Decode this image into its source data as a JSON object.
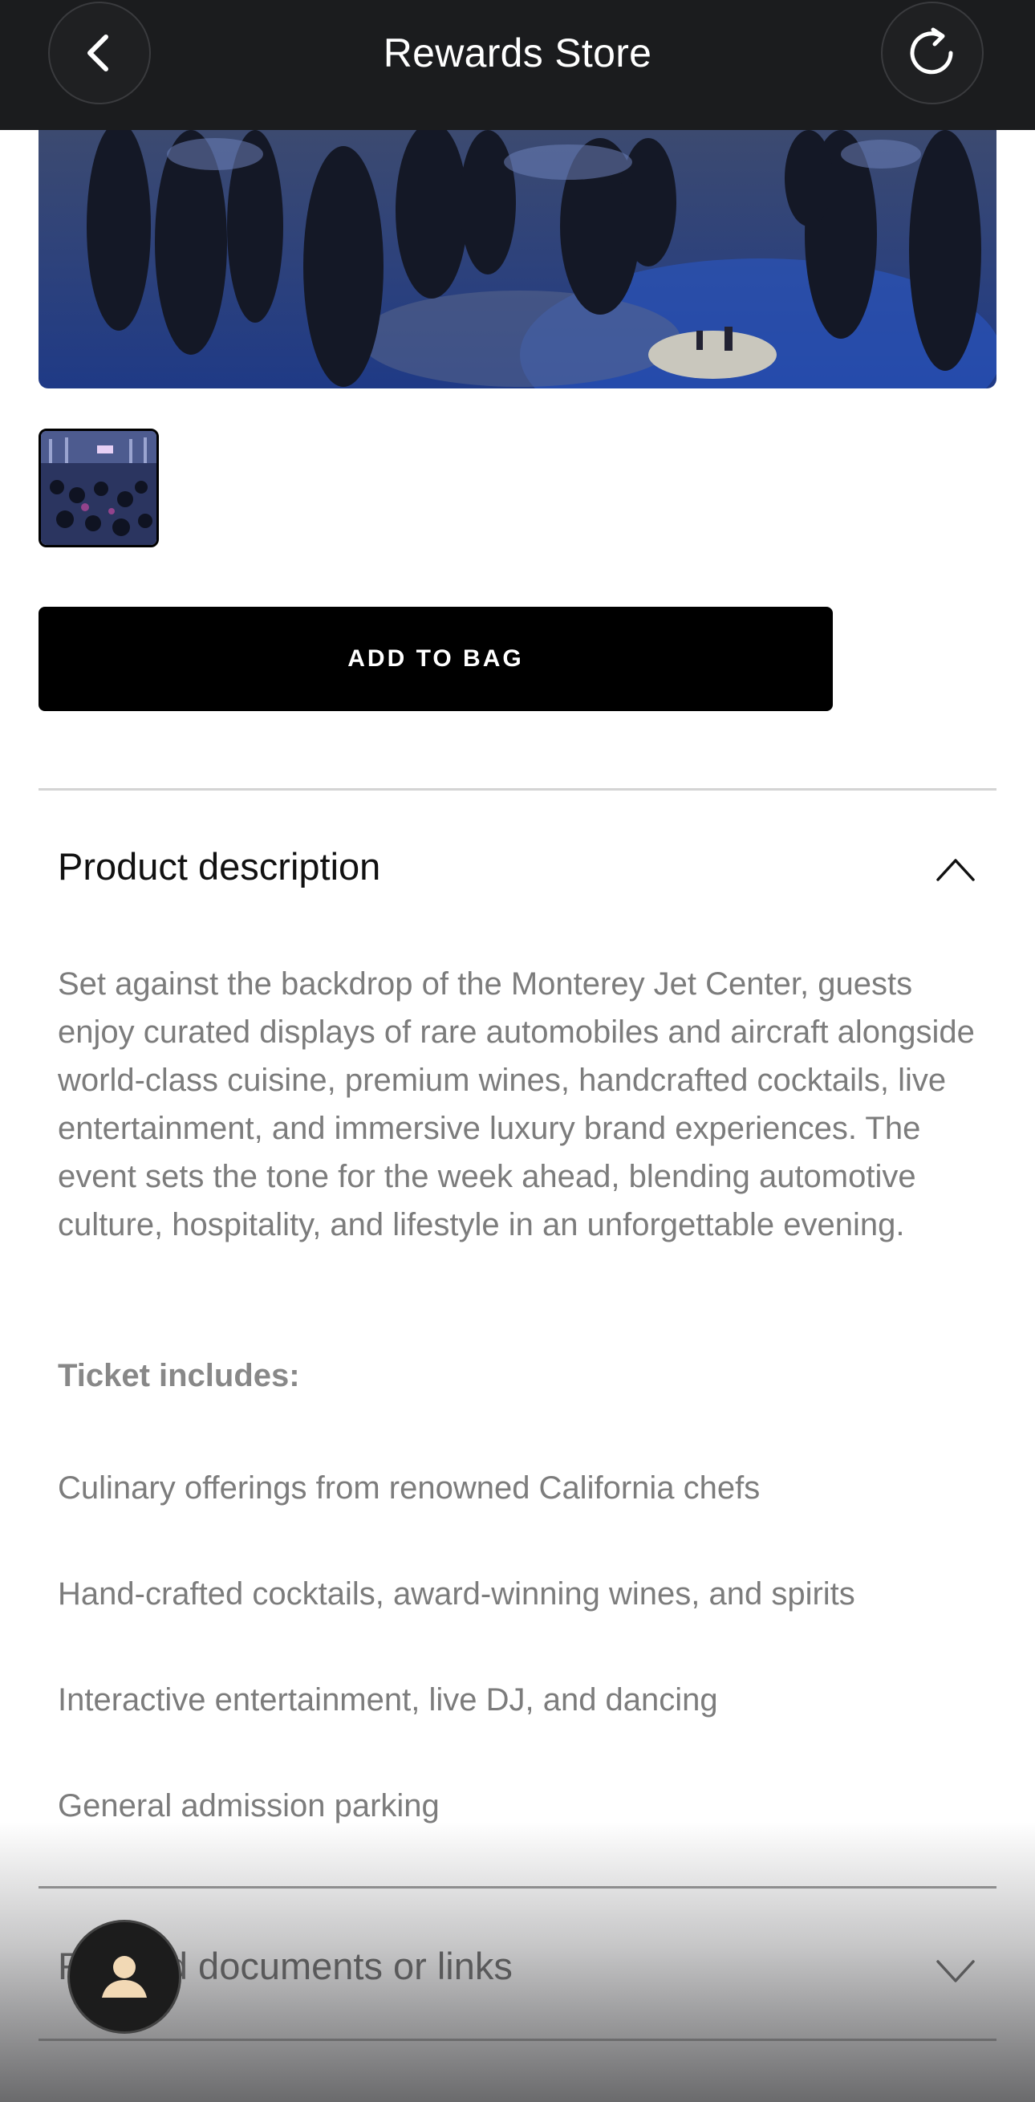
{
  "header": {
    "title": "Rewards Store",
    "back_icon": "chevron-left-icon",
    "refresh_icon": "refresh-icon"
  },
  "product": {
    "add_to_bag_label": "ADD TO BAG"
  },
  "description_section": {
    "title": "Product description",
    "expanded": true,
    "body": "Set against the backdrop of the Monterey Jet Center, guests enjoy curated displays of rare automobiles and aircraft alongside world-class cuisine, premium wines, handcrafted cocktails, live entertainment, and immersive luxury brand experiences. The event sets the tone for the week ahead, blending automotive culture, hospitality, and lifestyle in an unforgettable evening.",
    "includes_title": "Ticket includes:",
    "includes": [
      "Culinary offerings from renowned California chefs",
      "Hand-crafted cocktails, award-winning wines, and spirits",
      "Interactive entertainment, live DJ, and dancing",
      "General admission parking"
    ]
  },
  "related_section": {
    "title": "Related documents or links",
    "expanded": false
  },
  "colors": {
    "header_bg": "#1b1c1e",
    "button_bg": "#000000",
    "body_text": "#7c7c7c"
  }
}
